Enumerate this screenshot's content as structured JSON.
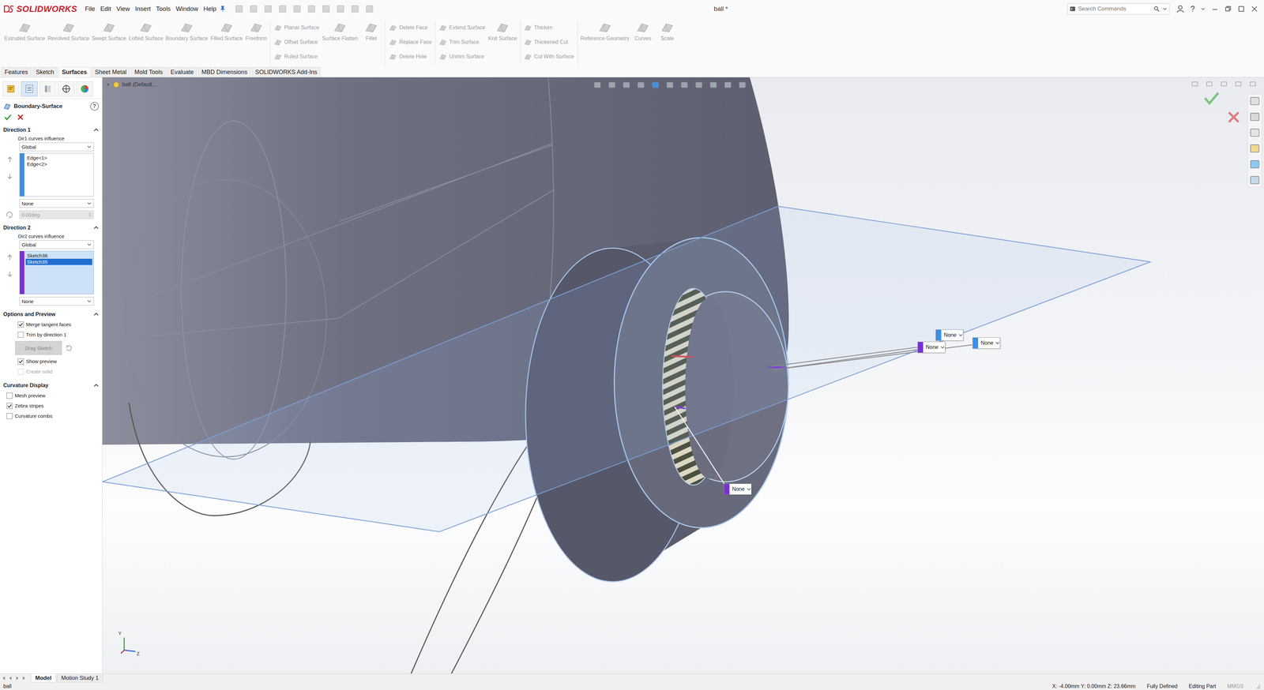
{
  "window": {
    "logo": "SOLIDWORKS",
    "title": "ball *",
    "help": "?"
  },
  "menus": [
    "File",
    "Edit",
    "View",
    "Insert",
    "Tools",
    "Window",
    "Help"
  ],
  "search": {
    "placeholder": "Search Commands"
  },
  "ribbon": [
    {
      "items": [
        {
          "kind": "large",
          "label": "Extruded Surface",
          "disabled": true
        },
        {
          "kind": "large",
          "label": "Revolved Surface",
          "disabled": true
        },
        {
          "kind": "large",
          "label": "Swept Surface",
          "disabled": true
        },
        {
          "kind": "large",
          "label": "Lofted Surface",
          "disabled": true
        },
        {
          "kind": "large",
          "label": "Boundary Surface",
          "disabled": true
        },
        {
          "kind": "large",
          "label": "Filled Surface",
          "disabled": true
        },
        {
          "kind": "large",
          "label": "Freeform",
          "disabled": true
        }
      ]
    },
    {
      "items": [
        {
          "kind": "stack",
          "items": [
            {
              "label": "Planar Surface",
              "disabled": true
            },
            {
              "label": "Offset Surface",
              "disabled": true
            },
            {
              "label": "Ruled Surface",
              "disabled": true
            }
          ]
        },
        {
          "kind": "large",
          "label": "Surface Flatten",
          "disabled": true
        },
        {
          "kind": "large",
          "label": "Fillet",
          "disabled": true
        }
      ]
    },
    {
      "items": [
        {
          "kind": "stack",
          "items": [
            {
              "label": "Delete Face",
              "disabled": true
            },
            {
              "label": "Replace Face",
              "disabled": true
            },
            {
              "label": "Delete Hole",
              "disabled": true
            }
          ]
        }
      ]
    },
    {
      "items": [
        {
          "kind": "stack",
          "items": [
            {
              "label": "Extend Surface",
              "disabled": true
            },
            {
              "label": "Trim Surface",
              "disabled": true
            },
            {
              "label": "Untrim Surface",
              "disabled": true
            }
          ]
        },
        {
          "kind": "large",
          "label": "Knit Surface",
          "disabled": true
        }
      ]
    },
    {
      "items": [
        {
          "kind": "stack",
          "items": [
            {
              "label": "Thicken",
              "disabled": true
            },
            {
              "label": "Thickened Cut",
              "disabled": true
            },
            {
              "label": "Cut With Surface",
              "disabled": true
            }
          ]
        }
      ]
    },
    {
      "items": [
        {
          "kind": "large",
          "label": "Reference Geometry",
          "disabled": true
        },
        {
          "kind": "large",
          "label": "Curves",
          "disabled": true
        },
        {
          "kind": "large",
          "label": "Scale",
          "disabled": true
        }
      ]
    }
  ],
  "command_tabs": [
    {
      "label": "Features",
      "selected": false
    },
    {
      "label": "Sketch",
      "selected": false
    },
    {
      "label": "Surfaces",
      "selected": true
    },
    {
      "label": "Sheet Metal",
      "selected": false
    },
    {
      "label": "Mold Tools",
      "selected": false
    },
    {
      "label": "Evaluate",
      "selected": false
    },
    {
      "label": "MBD Dimensions",
      "selected": false
    },
    {
      "label": "SOLIDWORKS Add-Ins",
      "selected": false
    }
  ],
  "panel_tabs": [
    {
      "selected": false
    },
    {
      "selected": true
    },
    {
      "selected": false
    },
    {
      "selected": false
    },
    {
      "selected": false
    }
  ],
  "property_manager": {
    "title": "Boundary-Surface",
    "help": "?",
    "sections": [
      {
        "kind": "direction",
        "title": "Direction 1",
        "expanded": true,
        "color": "#3a8fe6",
        "active": false,
        "influence_label": "Dir1 curves influence",
        "influence": "Global",
        "curves": [
          {
            "label": "Edge<1>",
            "selected": false
          },
          {
            "label": "Edge<2>",
            "selected": false
          }
        ],
        "tangency": "None",
        "angle": {
          "value": "0.00deg",
          "disabled": true
        }
      },
      {
        "kind": "direction",
        "title": "Direction 2",
        "expanded": true,
        "color": "#7b2fd6",
        "active": true,
        "influence_label": "Dir2 curves influence",
        "influence": "Global",
        "curves": [
          {
            "label": "Sketch36",
            "selected": false
          },
          {
            "label": "Sketch35",
            "selected": true
          }
        ],
        "tangency": "None"
      },
      {
        "kind": "options",
        "title": "Options and Preview",
        "expanded": true,
        "controls": [
          {
            "kind": "checkbox",
            "label": "Merge tangent faces",
            "checked": true,
            "disabled": false
          },
          {
            "kind": "checkbox",
            "label": "Trim by direction 1",
            "checked": false,
            "disabled": false
          },
          {
            "kind": "button",
            "label": "Drag Sketch",
            "disabled": true
          },
          {
            "kind": "checkbox",
            "label": "Show preview",
            "checked": true,
            "disabled": false
          },
          {
            "kind": "checkbox",
            "label": "Create solid",
            "checked": false,
            "disabled": true
          }
        ]
      },
      {
        "kind": "curvature",
        "title": "Curvature Display",
        "expanded": true,
        "controls": [
          {
            "kind": "checkbox",
            "label": "Mesh preview",
            "checked": false,
            "disabled": false
          },
          {
            "kind": "checkbox",
            "label": "Zebra stripes",
            "checked": true,
            "disabled": false
          },
          {
            "kind": "checkbox",
            "label": "Curvature combs",
            "checked": false,
            "disabled": false
          }
        ]
      }
    ]
  },
  "viewport": {
    "breadcrumb": "ball (Default...",
    "callouts": [
      {
        "label": "None",
        "color": "#3a8fe6"
      },
      {
        "label": "None",
        "color": "#7b2fd6"
      },
      {
        "label": "None",
        "color": "#3a8fe6"
      },
      {
        "label": "None",
        "color": "#7b2fd6"
      }
    ],
    "triad": [
      "Y",
      "Z"
    ]
  },
  "model_tabs": [
    {
      "label": "Model",
      "selected": true
    },
    {
      "label": "Motion Study 1",
      "selected": false
    }
  ],
  "status_bar": {
    "file": "ball",
    "coordinates": "X: -4.00mm Y: 0.00mm Z: 23.66mm",
    "state": "Fully Defined",
    "mode": "Editing Part",
    "units": "MMGS"
  }
}
